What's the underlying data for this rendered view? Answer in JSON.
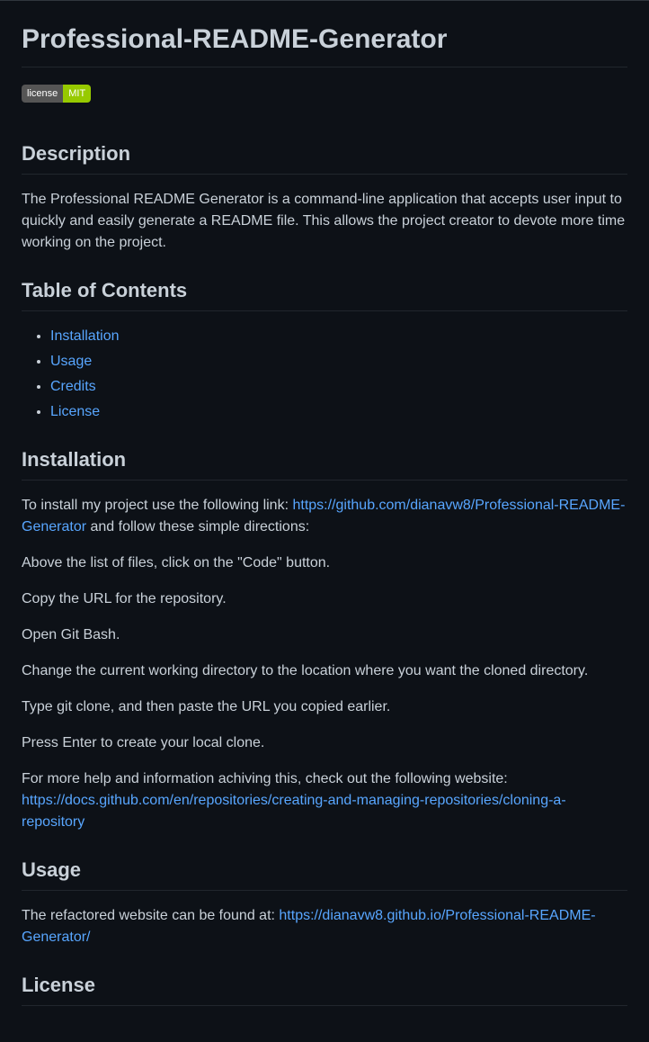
{
  "title": "Professional-README-Generator",
  "badge": {
    "left": "license",
    "right": "MIT"
  },
  "description": {
    "heading": "Description",
    "text": "The Professional README Generator is a command-line application that accepts user input to quickly and easily generate a README file. This allows the project creator to devote more time working on the project."
  },
  "toc": {
    "heading": "Table of Contents",
    "items": [
      "Installation",
      "Usage",
      "Credits",
      "License"
    ]
  },
  "installation": {
    "heading": "Installation",
    "intro_prefix": "To install my project use the following link: ",
    "intro_link": "https://github.com/dianavw8/Professional-README-Generator",
    "intro_suffix": " and follow these simple directions:",
    "steps": [
      "Above the list of files, click on the \"Code\" button.",
      "Copy the URL for the repository.",
      "Open Git Bash.",
      "Change the current working directory to the location where you want the cloned directory.",
      "Type git clone, and then paste the URL you copied earlier.",
      "Press Enter to create your local clone."
    ],
    "help_text": "For more help and information achiving this, check out the following website: ",
    "help_link": "https://docs.github.com/en/repositories/creating-and-managing-repositories/cloning-a-repository"
  },
  "usage": {
    "heading": "Usage",
    "text_prefix": "The refactored website can be found at: ",
    "link": "https://dianavw8.github.io/Professional-README-Generator/"
  },
  "license": {
    "heading": "License"
  }
}
